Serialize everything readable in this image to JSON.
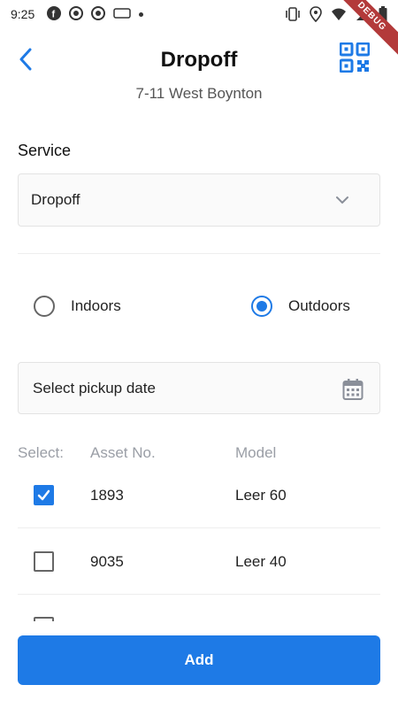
{
  "status_bar": {
    "time": "9:25",
    "debug_label": "DEBUG"
  },
  "header": {
    "title": "Dropoff",
    "subtitle": "7-11 West Boynton"
  },
  "service": {
    "label": "Service",
    "selected": "Dropoff"
  },
  "location": {
    "options": [
      {
        "label": "Indoors",
        "selected": false
      },
      {
        "label": "Outdoors",
        "selected": true
      }
    ]
  },
  "pickup_date": {
    "placeholder": "Select pickup date"
  },
  "assets_table": {
    "columns": [
      "Select:",
      "Asset No.",
      "Model"
    ],
    "rows": [
      {
        "asset_no": "1893",
        "model": "Leer 60",
        "checked": true
      },
      {
        "asset_no": "9035",
        "model": "Leer 40",
        "checked": false
      }
    ]
  },
  "actions": {
    "add_label": "Add"
  },
  "colors": {
    "accent": "#1e7ae6",
    "muted_text": "#9a9ea6"
  }
}
